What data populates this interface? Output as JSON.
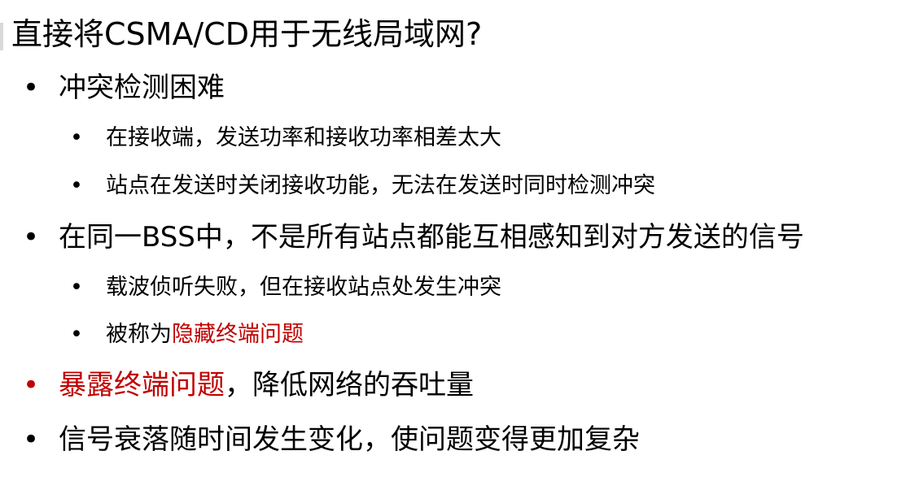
{
  "title": "直接将CSMA/CD用于无线局域网?",
  "bullet_symbol": "•",
  "colors": {
    "text": "#000000",
    "highlight": "#c00000"
  },
  "items": [
    {
      "text": "冲突检测困难"
    },
    {
      "text": "在接收端，发送功率和接收功率相差太大"
    },
    {
      "text": "站点在发送时关闭接收功能，无法在发送时同时检测冲突"
    },
    {
      "text": "在同一BSS中，不是所有站点都能互相感知到对方发送的信号"
    },
    {
      "text": "载波侦听失败，但在接收站点处发生冲突"
    },
    {
      "prefix": "被称为",
      "highlight": "隐藏终端问题"
    },
    {
      "highlight": "暴露终端问题",
      "suffix": "，降低网络的吞吐量"
    },
    {
      "text": "信号衰落随时间发生变化，使问题变得更加复杂"
    }
  ]
}
